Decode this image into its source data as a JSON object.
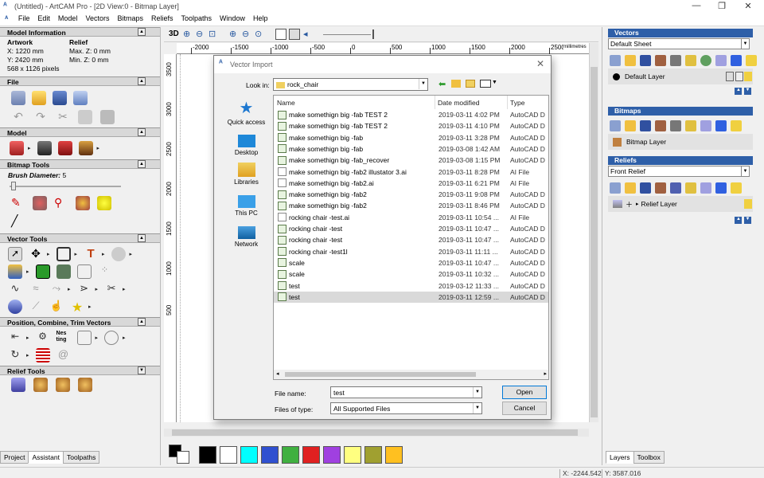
{
  "window": {
    "title": "(Untitled) - ArtCAM Pro - [2D View:0 - Bitmap Layer]",
    "minimize": "—",
    "restore": "❐",
    "close": "✕"
  },
  "menu": [
    "File",
    "Edit",
    "Model",
    "Vectors",
    "Bitmaps",
    "Reliefs",
    "Toolpaths",
    "Window",
    "Help"
  ],
  "left": {
    "model_info": {
      "title": "Model Information",
      "artwork_label": "Artwork",
      "relief_label": "Relief",
      "x": "X: 1220 mm",
      "y": "Y: 2420 mm",
      "maxz": "Max. Z: 0 mm",
      "minz": "Min. Z: 0 mm",
      "pixels": "568 x 1126 pixels"
    },
    "file": {
      "title": "File"
    },
    "model": {
      "title": "Model"
    },
    "bitmap_tools": {
      "title": "Bitmap Tools",
      "brush_label": "Brush Diameter:",
      "brush_value": "5"
    },
    "vector_tools": {
      "title": "Vector Tools",
      "nesting_label": "Nes ting"
    },
    "position": {
      "title": "Position, Combine, Trim Vectors"
    },
    "relief_tools": {
      "title": "Relief Tools"
    },
    "tabs": [
      "Project",
      "Assistant",
      "Toolpaths"
    ]
  },
  "view": {
    "label_3d": "3D",
    "ruler_h": [
      "-2000",
      "-1500",
      "-1000",
      "-500",
      "0",
      "500",
      "1000",
      "1500",
      "2000",
      "2500"
    ],
    "ruler_unit": "millimetres",
    "ruler_v": [
      "3500",
      "3000",
      "2500",
      "2000",
      "1500",
      "1000",
      "500"
    ]
  },
  "palette": {
    "colors": [
      "#000000",
      "#ffffff",
      "#00ffff",
      "#3050d0",
      "#40b040",
      "#e02020",
      "#a040e0",
      "#ffff80",
      "#a0a030",
      "#ffc020"
    ]
  },
  "right": {
    "vectors": {
      "title": "Vectors",
      "sheet": "Default Sheet",
      "layer": "Default Layer"
    },
    "bitmaps": {
      "title": "Bitmaps",
      "layer": "Bitmap Layer"
    },
    "reliefs": {
      "title": "Reliefs",
      "select": "Front Relief",
      "layer": "Relief Layer"
    },
    "tabs": [
      "Layers",
      "Toolbox"
    ]
  },
  "status": {
    "x": "X: -2244.542",
    "y": "Y: 3587.016"
  },
  "dialog": {
    "title": "Vector Import",
    "look_in_label": "Look in:",
    "look_in_value": "rock_chair",
    "places": [
      "Quick access",
      "Desktop",
      "Libraries",
      "This PC",
      "Network"
    ],
    "columns": [
      "Name",
      "Date modified",
      "Type"
    ],
    "files": [
      {
        "name": "make somethign big -fab TEST 2",
        "date": "2019-03-11 4:02 PM",
        "type": "AutoCAD D",
        "kind": "cad"
      },
      {
        "name": "make somethign big -fab TEST 2",
        "date": "2019-03-11 4:10 PM",
        "type": "AutoCAD D",
        "kind": "cad"
      },
      {
        "name": "make somethign big -fab",
        "date": "2019-03-11 3:28 PM",
        "type": "AutoCAD D",
        "kind": "cad"
      },
      {
        "name": "make somethign big -fab",
        "date": "2019-03-08 1:42 AM",
        "type": "AutoCAD D",
        "kind": "cad"
      },
      {
        "name": "make somethign big -fab_recover",
        "date": "2019-03-08 1:15 PM",
        "type": "AutoCAD D",
        "kind": "cad"
      },
      {
        "name": "make somethign big -fab2 illustator 3.ai",
        "date": "2019-03-11 8:28 PM",
        "type": "AI File",
        "kind": "ai"
      },
      {
        "name": "make somethign big -fab2.ai",
        "date": "2019-03-11 6:21 PM",
        "type": "AI File",
        "kind": "ai"
      },
      {
        "name": "make somethign big -fab2",
        "date": "2019-03-11 9:08 PM",
        "type": "AutoCAD D",
        "kind": "cad"
      },
      {
        "name": "make somethign big -fab2",
        "date": "2019-03-11 8:46 PM",
        "type": "AutoCAD D",
        "kind": "cad"
      },
      {
        "name": "rocking chair -test.ai",
        "date": "2019-03-11 10:54 ...",
        "type": "AI File",
        "kind": "ai"
      },
      {
        "name": "rocking chair -test",
        "date": "2019-03-11 10:47 ...",
        "type": "AutoCAD D",
        "kind": "cad"
      },
      {
        "name": "rocking chair -test",
        "date": "2019-03-11 10:47 ...",
        "type": "AutoCAD D",
        "kind": "cad"
      },
      {
        "name": "rocking chair -test1l",
        "date": "2019-03-11 11:11 ...",
        "type": "AutoCAD D",
        "kind": "cad"
      },
      {
        "name": "scale",
        "date": "2019-03-11 10:47 ...",
        "type": "AutoCAD D",
        "kind": "cad"
      },
      {
        "name": "scale",
        "date": "2019-03-11 10:32 ...",
        "type": "AutoCAD D",
        "kind": "cad"
      },
      {
        "name": "test",
        "date": "2019-03-12 11:33 ...",
        "type": "AutoCAD D",
        "kind": "cad"
      },
      {
        "name": "test",
        "date": "2019-03-11 12:59 ...",
        "type": "AutoCAD D",
        "kind": "cad",
        "selected": true
      }
    ],
    "filename_label": "File name:",
    "filename_value": "test",
    "filetype_label": "Files of type:",
    "filetype_value": "All Supported Files",
    "open_label": "Open",
    "cancel_label": "Cancel"
  }
}
